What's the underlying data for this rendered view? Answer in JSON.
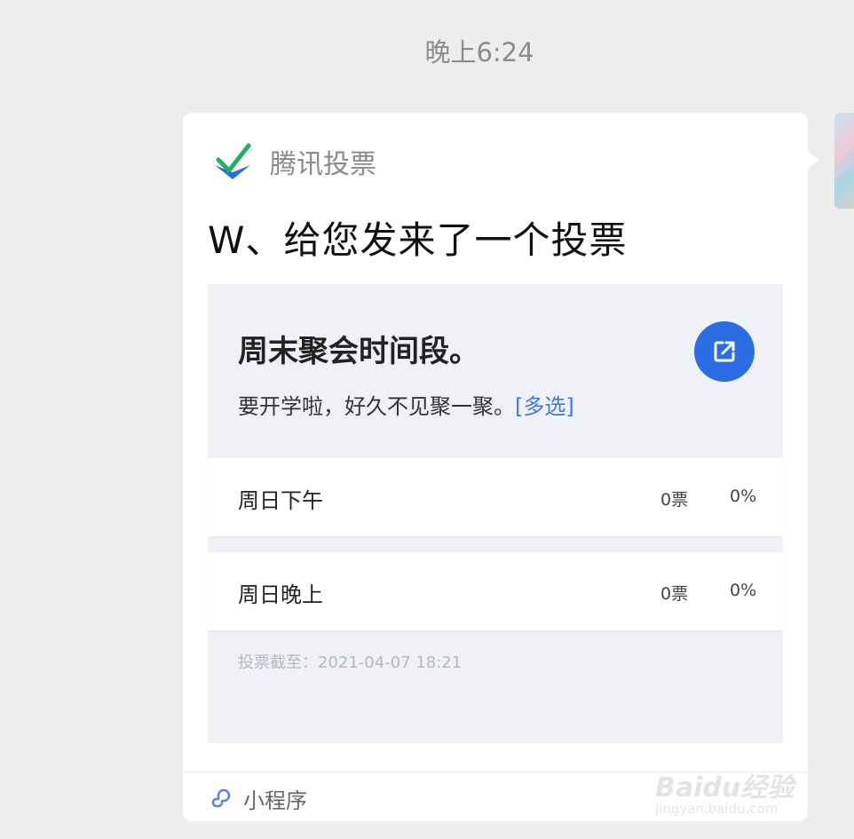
{
  "chat": {
    "timestamp": "晚上6:24"
  },
  "card": {
    "brand_name": "腾讯投票",
    "invite_title": "W、给您发来了一个投票",
    "vote": {
      "title": "周末聚会时间段。",
      "description": "要开学啦，好久不见聚一聚。",
      "tag": "[多选]",
      "options": [
        {
          "label": "周日下午",
          "votes": "0票",
          "percent": "0%"
        },
        {
          "label": "周日晚上",
          "votes": "0票",
          "percent": "0%"
        }
      ],
      "deadline": "投票截至：2021-04-07 18:21"
    },
    "footer_label": "小程序"
  },
  "watermark": {
    "main": "Baidu经验",
    "sub": "jingyan.baidu.com"
  },
  "colors": {
    "accent_blue": "#2b6de5",
    "tag_blue": "#3b7ad9",
    "logo_green": "#1fb25a",
    "logo_blue": "#2b6de5"
  },
  "icons": [
    "tencent-vote-logo-icon",
    "share-icon",
    "mini-program-icon"
  ]
}
